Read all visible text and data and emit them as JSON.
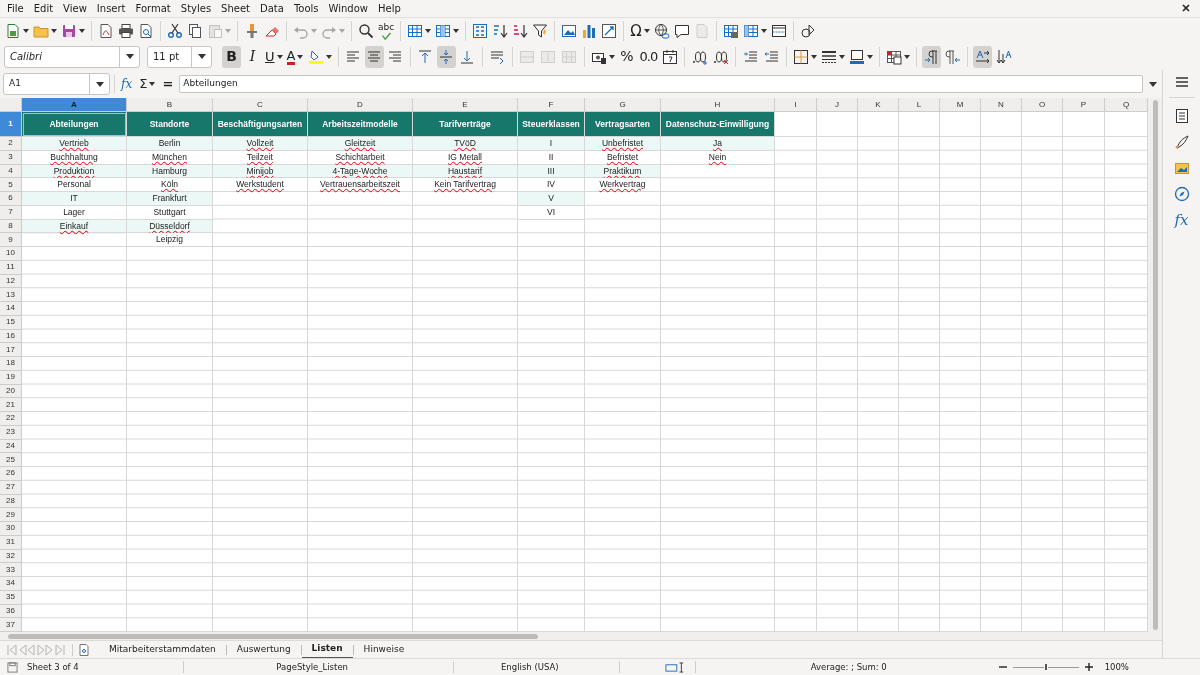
{
  "menu": [
    "File",
    "Edit",
    "View",
    "Insert",
    "Format",
    "Styles",
    "Sheet",
    "Data",
    "Tools",
    "Window",
    "Help"
  ],
  "standard_toolbar": [
    {
      "disabled": false
    },
    {
      "disabled": false
    },
    {
      "disabled": false
    },
    {
      "disabled": false
    },
    {
      "disabled": false
    },
    {
      "disabled": false
    },
    {
      "disabled": false
    },
    {
      "disabled": false
    },
    {
      "disabled": true
    },
    {
      "disabled": false
    },
    {
      "disabled": false
    },
    {
      "disabled": true
    },
    {
      "disabled": true
    },
    {
      "disabled": false
    },
    {
      "disabled": false,
      "label": "abc"
    },
    {
      "disabled": false
    },
    {
      "disabled": false
    },
    {
      "disabled": false
    },
    {
      "disabled": false
    },
    {
      "disabled": false
    },
    {
      "disabled": false
    },
    {
      "disabled": false
    },
    {
      "disabled": false
    },
    {
      "disabled": false
    },
    {
      "disabled": false,
      "label": "Ω"
    },
    {
      "disabled": false
    },
    {
      "disabled": false
    },
    {
      "disabled": true
    },
    {
      "disabled": false
    },
    {
      "disabled": false
    },
    {
      "disabled": false
    },
    {
      "disabled": false
    }
  ],
  "font_name": "Calibri",
  "font_size": "11 pt",
  "format_toolbar": [
    {
      "label": "B",
      "pressed": true,
      "disabled": false
    },
    {
      "label": "I",
      "pressed": false,
      "disabled": false
    },
    {
      "label": "U",
      "pressed": false,
      "disabled": false
    },
    {
      "label": "A",
      "pressed": false,
      "disabled": false
    },
    {
      "pressed": false,
      "disabled": false
    },
    {
      "pressed": false,
      "disabled": false
    },
    {
      "pressed": true,
      "disabled": false
    },
    {
      "pressed": false,
      "disabled": false
    },
    {
      "pressed": false,
      "disabled": false
    },
    {
      "pressed": true,
      "disabled": false
    },
    {
      "pressed": false,
      "disabled": false
    },
    {
      "pressed": false,
      "disabled": false
    },
    {
      "pressed": false,
      "disabled": true
    },
    {
      "pressed": false,
      "disabled": true
    },
    {
      "pressed": false,
      "disabled": true
    },
    {
      "pressed": false,
      "disabled": false
    },
    {
      "label": "%",
      "pressed": false,
      "disabled": false
    },
    {
      "label": "0.0",
      "pressed": false,
      "disabled": false
    },
    {
      "pressed": false,
      "disabled": false
    },
    {
      "pressed": false,
      "disabled": false
    },
    {
      "pressed": false,
      "disabled": false
    },
    {
      "pressed": false,
      "disabled": false
    },
    {
      "pressed": false,
      "disabled": false
    },
    {
      "pressed": false,
      "disabled": false
    },
    {
      "pressed": false,
      "disabled": false
    },
    {
      "pressed": false,
      "disabled": false
    },
    {
      "pressed": false,
      "disabled": false
    },
    {
      "pressed": true,
      "disabled": false
    },
    {
      "pressed": false,
      "disabled": false
    },
    {
      "pressed": true,
      "disabled": false
    },
    {
      "pressed": false,
      "disabled": false
    }
  ],
  "formula_bar": {
    "name_box": "A1",
    "function_wizard": "fx",
    "sum": "Σ",
    "equals": "=",
    "content": "Abteilungen"
  },
  "columns": [
    {
      "letter": "A",
      "selected": true
    },
    {
      "letter": "B",
      "selected": false
    },
    {
      "letter": "C",
      "selected": false
    },
    {
      "letter": "D",
      "selected": false
    },
    {
      "letter": "E",
      "selected": false
    },
    {
      "letter": "F",
      "selected": false
    },
    {
      "letter": "G",
      "selected": false
    },
    {
      "letter": "H",
      "selected": false
    },
    {
      "letter": "I",
      "selected": false
    },
    {
      "letter": "J",
      "selected": false
    },
    {
      "letter": "K",
      "selected": false
    },
    {
      "letter": "L",
      "selected": false
    },
    {
      "letter": "M",
      "selected": false
    },
    {
      "letter": "N",
      "selected": false
    },
    {
      "letter": "O",
      "selected": false
    },
    {
      "letter": "P",
      "selected": false
    },
    {
      "letter": "Q",
      "selected": false
    }
  ],
  "rows": [
    {
      "number": "1",
      "selected": true,
      "kind": "header",
      "cells": [
        {
          "text": "Abteilungen",
          "selected": true
        },
        {
          "text": "Standorte",
          "selected": false
        },
        {
          "text": "Beschäftigungsarten",
          "selected": false
        },
        {
          "text": "Arbeitszeitmodelle",
          "selected": false
        },
        {
          "text": "Tarifverträge",
          "selected": false
        },
        {
          "text": "Steuerklassen",
          "selected": false
        },
        {
          "text": "Vertragsarten",
          "selected": false
        },
        {
          "text": "Datenschutz-Einwilligung",
          "selected": false
        }
      ]
    },
    {
      "number": "2",
      "selected": false,
      "kind": "data",
      "cells": [
        {
          "text": "Vertrieb",
          "flagged": true
        },
        {
          "text": "Berlin",
          "flagged": false
        },
        {
          "text": "Vollzeit",
          "flagged": true
        },
        {
          "text": "Gleitzeit",
          "flagged": true
        },
        {
          "text": "TVöD",
          "flagged": true
        },
        {
          "text": "I",
          "flagged": false
        },
        {
          "text": "Unbefristet",
          "flagged": true
        },
        {
          "text": "Ja",
          "flagged": true
        }
      ]
    },
    {
      "number": "3",
      "selected": false,
      "kind": "data",
      "cells": [
        {
          "text": "Buchhaltung",
          "flagged": true
        },
        {
          "text": "München",
          "flagged": true
        },
        {
          "text": "Teilzeit",
          "flagged": true
        },
        {
          "text": "Schichtarbeit",
          "flagged": true
        },
        {
          "text": "IG Metall",
          "flagged": true
        },
        {
          "text": "II",
          "flagged": false
        },
        {
          "text": "Befristet",
          "flagged": true
        },
        {
          "text": "Nein",
          "flagged": true
        }
      ]
    },
    {
      "number": "4",
      "selected": false,
      "kind": "data",
      "cells": [
        {
          "text": "Produktion",
          "flagged": true
        },
        {
          "text": "Hamburg",
          "flagged": false
        },
        {
          "text": "Minijob",
          "flagged": true
        },
        {
          "text": "4-Tage-Woche",
          "flagged": true
        },
        {
          "text": "Haustarif",
          "flagged": true
        },
        {
          "text": "III",
          "flagged": false
        },
        {
          "text": "Praktikum",
          "flagged": true
        }
      ]
    },
    {
      "number": "5",
      "selected": false,
      "kind": "data",
      "cells": [
        {
          "text": "Personal",
          "flagged": false
        },
        {
          "text": "Köln",
          "flagged": true
        },
        {
          "text": "Werkstudent",
          "flagged": true
        },
        {
          "text": "Vertrauensarbeitszeit",
          "flagged": true
        },
        {
          "text": "Kein Tarifvertrag",
          "flagged": true
        },
        {
          "text": "IV",
          "flagged": false
        },
        {
          "text": "Werkvertrag",
          "flagged": true
        }
      ]
    },
    {
      "number": "6",
      "selected": false,
      "kind": "data",
      "cells": [
        {
          "text": "IT",
          "flagged": false
        },
        {
          "text": "Frankfurt",
          "flagged": false
        },
        null,
        null,
        null,
        {
          "text": "V",
          "flagged": false
        }
      ]
    },
    {
      "number": "7",
      "selected": false,
      "kind": "data",
      "cells": [
        {
          "text": "Lager",
          "flagged": false
        },
        {
          "text": "Stuttgart",
          "flagged": false
        },
        null,
        null,
        null,
        {
          "text": "VI",
          "flagged": false
        }
      ]
    },
    {
      "number": "8",
      "selected": false,
      "kind": "data",
      "cells": [
        {
          "text": "Einkauf",
          "flagged": true
        },
        {
          "text": "Düsseldorf",
          "flagged": true
        }
      ]
    },
    {
      "number": "9",
      "selected": false,
      "kind": "data",
      "cells": [
        null,
        {
          "text": "Leipzig",
          "flagged": false
        }
      ]
    },
    {
      "number": "10",
      "selected": false,
      "kind": "data"
    },
    {
      "number": "11",
      "selected": false,
      "kind": "data"
    },
    {
      "number": "12",
      "selected": false,
      "kind": "data"
    },
    {
      "number": "13",
      "selected": false,
      "kind": "data"
    },
    {
      "number": "14",
      "selected": false,
      "kind": "data"
    },
    {
      "number": "15",
      "selected": false,
      "kind": "data"
    },
    {
      "number": "16",
      "selected": false,
      "kind": "data"
    },
    {
      "number": "17",
      "selected": false,
      "kind": "data"
    },
    {
      "number": "18",
      "selected": false,
      "kind": "data"
    },
    {
      "number": "19",
      "selected": false,
      "kind": "data"
    },
    {
      "number": "20",
      "selected": false,
      "kind": "data"
    },
    {
      "number": "21",
      "selected": false,
      "kind": "data"
    },
    {
      "number": "22",
      "selected": false,
      "kind": "data"
    },
    {
      "number": "23",
      "selected": false,
      "kind": "data"
    },
    {
      "number": "24",
      "selected": false,
      "kind": "data"
    },
    {
      "number": "25",
      "selected": false,
      "kind": "data"
    },
    {
      "number": "26",
      "selected": false,
      "kind": "data"
    },
    {
      "number": "27",
      "selected": false,
      "kind": "data"
    },
    {
      "number": "28",
      "selected": false,
      "kind": "data"
    },
    {
      "number": "29",
      "selected": false,
      "kind": "data"
    },
    {
      "number": "30",
      "selected": false,
      "kind": "data"
    },
    {
      "number": "31",
      "selected": false,
      "kind": "data"
    },
    {
      "number": "32",
      "selected": false,
      "kind": "data"
    },
    {
      "number": "33",
      "selected": false,
      "kind": "data"
    },
    {
      "number": "34",
      "selected": false,
      "kind": "data"
    },
    {
      "number": "35",
      "selected": false,
      "kind": "data"
    },
    {
      "number": "36",
      "selected": false,
      "kind": "data"
    },
    {
      "number": "37",
      "selected": false,
      "kind": "data"
    }
  ],
  "sheet_tabs": [
    {
      "label": "Mitarbeiterstammdaten",
      "selected": false
    },
    {
      "label": "Auswertung",
      "selected": false
    },
    {
      "label": "Listen",
      "selected": true
    },
    {
      "label": "Hinweise",
      "selected": false
    }
  ],
  "sidebar": {
    "functions_label": "fx"
  },
  "status_bar": {
    "sheet": "Sheet 3 of 4",
    "page_style": "PageStyle_Listen",
    "language": "English (USA)",
    "summary": "Average: ; Sum: 0",
    "zoom": {
      "level": 0.5,
      "reading": "100%"
    }
  }
}
